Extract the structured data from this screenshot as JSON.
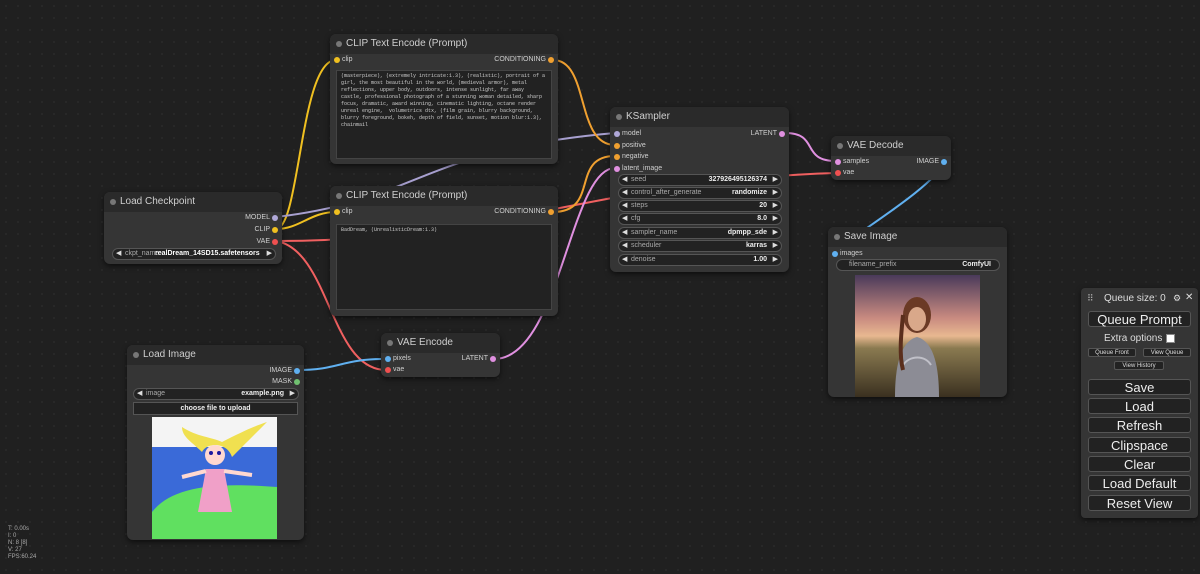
{
  "nodes": {
    "clip_pos": {
      "title": "CLIP Text Encode (Prompt)",
      "input_clip": "clip",
      "output": "CONDITIONING",
      "text": "(masterpiece), (extremely intricate:1.3), (realistic), portrait of a girl, the most beautiful in the world, (medieval armor), metal reflections, upper body, outdoors, intense sunlight, far away castle, professional photograph of a stunning woman detailed, sharp focus, dramatic, award winning, cinematic lighting, octane render  unreal engine,  volumetrics dtx, (film grain, blurry background, blurry foreground, bokeh, depth of field, sunset, motion blur:1.3), chainmail"
    },
    "clip_neg": {
      "title": "CLIP Text Encode (Prompt)",
      "input_clip": "clip",
      "output": "CONDITIONING",
      "text": "BadDream, (UnrealisticDream:1.3)"
    },
    "load_checkpoint": {
      "title": "Load Checkpoint",
      "out_model": "MODEL",
      "out_clip": "CLIP",
      "out_vae": "VAE",
      "ckpt_label": "ckpt_name",
      "ckpt_value": "realDream_14SD15.safetensors"
    },
    "ksampler": {
      "title": "KSampler",
      "in_model": "model",
      "in_positive": "positive",
      "in_negative": "negative",
      "in_latent": "latent_image",
      "out_latent": "LATENT",
      "widgets": [
        {
          "label": "seed",
          "value": "327926495126374"
        },
        {
          "label": "control_after_generate",
          "value": "randomize"
        },
        {
          "label": "steps",
          "value": "20"
        },
        {
          "label": "cfg",
          "value": "8.0"
        },
        {
          "label": "sampler_name",
          "value": "dpmpp_sde"
        },
        {
          "label": "scheduler",
          "value": "karras"
        },
        {
          "label": "denoise",
          "value": "1.00"
        }
      ]
    },
    "vae_decode": {
      "title": "VAE Decode",
      "in_samples": "samples",
      "in_vae": "vae",
      "out_image": "IMAGE"
    },
    "save_image": {
      "title": "Save Image",
      "in_images": "images",
      "prefix_label": "filename_prefix",
      "prefix_value": "ComfyUI"
    },
    "load_image": {
      "title": "Load Image",
      "out_image": "IMAGE",
      "out_mask": "MASK",
      "image_label": "image",
      "image_value": "example.png",
      "upload_label": "choose file to upload"
    },
    "vae_encode": {
      "title": "VAE Encode",
      "in_pixels": "pixels",
      "in_vae": "vae",
      "out_latent": "LATENT"
    }
  },
  "queue_panel": {
    "queue_size": "Queue size: 0",
    "queue_prompt": "Queue Prompt",
    "extra_options": "Extra options",
    "queue_front": "Queue Front",
    "view_queue": "View Queue",
    "view_history": "View History",
    "buttons": [
      "Save",
      "Load",
      "Refresh",
      "Clipspace",
      "Clear",
      "Load Default",
      "Reset View"
    ]
  },
  "stats": [
    "T: 0.00s",
    "I: 0",
    "N: 8 [8]",
    "V: 27",
    "FPS:60.24"
  ],
  "colors": {
    "clip": "#f0c020",
    "conditioning": "#f0a030",
    "model": "#b0a8d8",
    "vae": "#f05050",
    "latent": "#e090e0",
    "image": "#60b0f0",
    "mask": "#70c070"
  }
}
